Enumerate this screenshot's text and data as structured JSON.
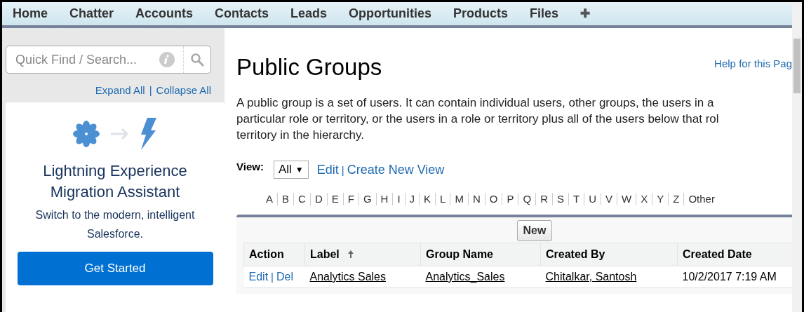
{
  "nav": {
    "items": [
      {
        "label": "Home"
      },
      {
        "label": "Chatter"
      },
      {
        "label": "Accounts"
      },
      {
        "label": "Contacts"
      },
      {
        "label": "Leads"
      },
      {
        "label": "Opportunities"
      },
      {
        "label": "Products"
      },
      {
        "label": "Files"
      },
      {
        "label": "✚"
      }
    ]
  },
  "sidebar": {
    "search": {
      "placeholder": "Quick Find / Search..."
    },
    "links": [
      "Expand All",
      "Collapse All"
    ],
    "link_separator": "|",
    "promo": {
      "title_lines": [
        "Lightning Experience",
        "Migration Assistant"
      ],
      "text_lines": [
        "Switch to the modern, intelligent",
        "Salesforce."
      ],
      "button": "Get Started"
    }
  },
  "main": {
    "title": "Public Groups",
    "help_link": "Help for this Pag",
    "description_lines": [
      "A public group is a set of users. It can contain individual users, other groups, the users in a",
      "particular role or territory, or the users in a role or territory plus all of the users below that rol",
      "territory in the hierarchy."
    ],
    "view": {
      "label": "View:",
      "value": "All",
      "caret": "▼",
      "links": [
        "Edit",
        "Create New View"
      ],
      "separator": "|"
    },
    "alphabet": [
      "A",
      "B",
      "C",
      "D",
      "E",
      "F",
      "G",
      "H",
      "I",
      "J",
      "K",
      "L",
      "M",
      "N",
      "O",
      "P",
      "Q",
      "R",
      "S",
      "T",
      "U",
      "V",
      "W",
      "X",
      "Y",
      "Z",
      "Other"
    ],
    "new_button": "New",
    "table": {
      "columns": [
        {
          "label": "Action",
          "sorted": false
        },
        {
          "label": "Label",
          "sorted": true
        },
        {
          "label": "Group Name",
          "sorted": false
        },
        {
          "label": "Created By",
          "sorted": false
        },
        {
          "label": "Created Date",
          "sorted": false
        }
      ],
      "rows": [
        {
          "cells": [
            {
              "kind": "actions",
              "links": [
                "Edit",
                "Del"
              ],
              "separator": "|"
            },
            {
              "kind": "link",
              "text": "Analytics Sales"
            },
            {
              "kind": "link",
              "text": "Analytics_Sales"
            },
            {
              "kind": "link",
              "text": "Chitalkar, Santosh"
            },
            {
              "kind": "text",
              "text": "10/2/2017 7:19 AM"
            }
          ]
        }
      ]
    }
  }
}
